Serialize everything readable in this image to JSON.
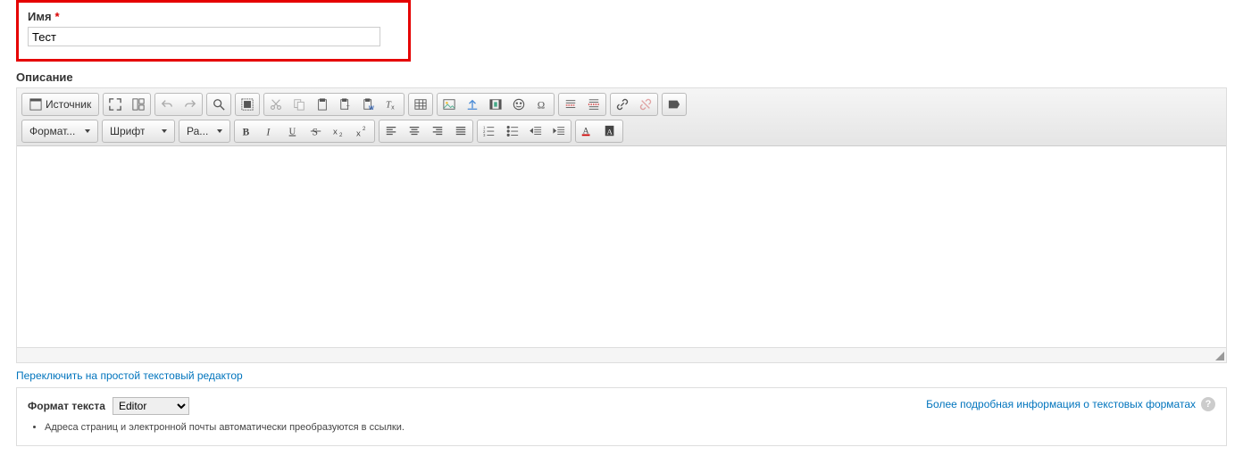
{
  "name": {
    "label": "Имя",
    "required_marker": "*",
    "value": "Тест"
  },
  "description": {
    "label": "Описание"
  },
  "toolbar": {
    "source": "Источник",
    "format_combo": "Формат...",
    "font_combo": "Шрифт",
    "size_combo": "Ра..."
  },
  "switch_link": "Переключить на простой текстовый редактор",
  "format": {
    "label": "Формат текста",
    "selected": "Editor",
    "hint": "Адреса страниц и электронной почты автоматически преобразуются в ссылки."
  },
  "help_link": "Более подробная информация о текстовых форматах",
  "help_mark": "?"
}
